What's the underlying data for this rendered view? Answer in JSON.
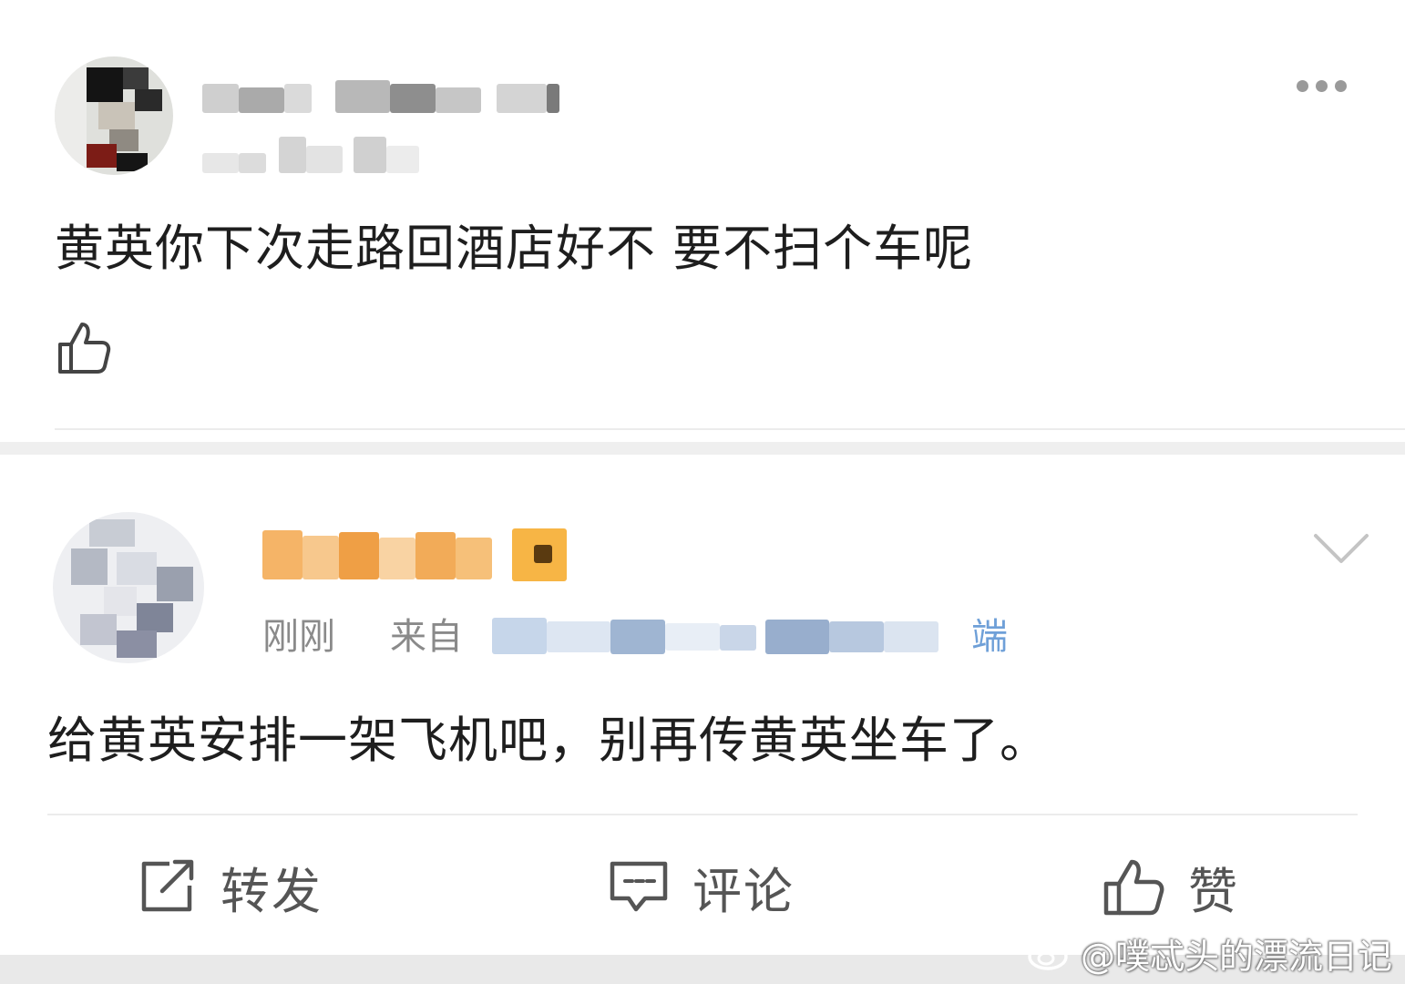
{
  "comments": [
    {
      "text": "黄英你下次走路回酒店好不 要不扫个车呢"
    },
    {
      "time": "刚刚",
      "source_prefix": "来自",
      "source_suffix": "端",
      "text": "给黄英安排一架飞机吧，别再传黄英坐车了。"
    }
  ],
  "actions": {
    "repost": "转发",
    "comment": "评论",
    "like": "赞"
  },
  "watermark": "@噗忒头的漂流日记",
  "icons": {
    "more": "more-dots-icon",
    "like": "thumbs-up-icon",
    "expand": "chevron-down-icon",
    "repost": "repost-icon",
    "comment": "comment-icon",
    "weibo": "weibo-logo-icon"
  },
  "colors": {
    "accent_orange": "#f2a23c",
    "text_gray": "#8a8a8a",
    "source_blue": "#6fa0d8"
  }
}
